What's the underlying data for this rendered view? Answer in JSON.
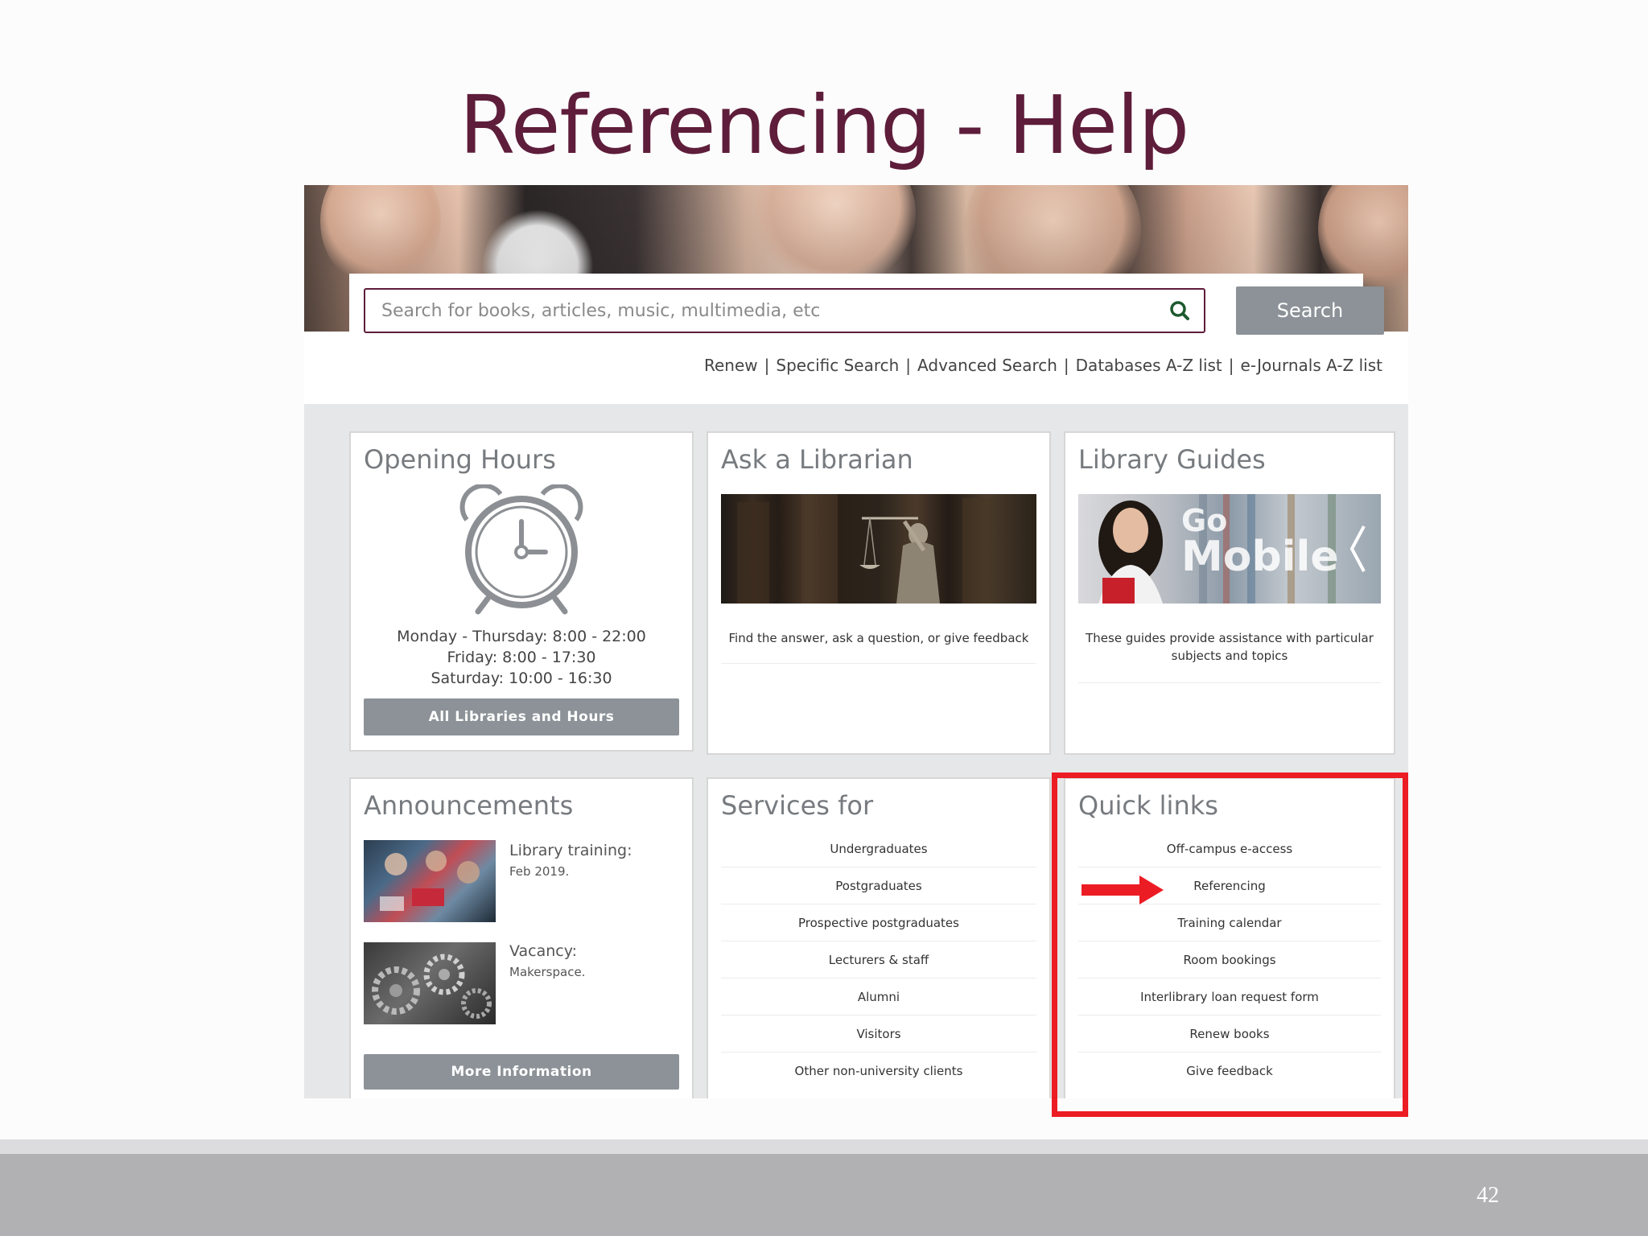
{
  "slide": {
    "title": "Referencing - Help",
    "page_number": "42"
  },
  "search": {
    "placeholder": "Search for books, articles, music, multimedia, etc",
    "button_label": "Search",
    "icon": "search-icon"
  },
  "quick_nav": [
    "Renew",
    "Specific Search",
    "Advanced Search",
    "Databases A-Z list",
    "e-Journals A-Z list"
  ],
  "cards": {
    "opening_hours": {
      "title": "Opening Hours",
      "icon": "alarm-clock-icon",
      "lines": [
        "Monday - Thursday: 8:00 - 22:00",
        "Friday: 8:00 - 17:30",
        "Saturday: 10:00 - 16:30"
      ],
      "button_label": "All Libraries and Hours"
    },
    "ask_librarian": {
      "title": "Ask a Librarian",
      "caption": "Find the answer, ask a question, or give feedback"
    },
    "library_guides": {
      "title": "Library Guides",
      "image_text_1": "Go",
      "image_text_2": "Mobile",
      "caption": "These guides provide assistance with particular subjects and topics"
    },
    "announcements": {
      "title": "Announcements",
      "items": [
        {
          "title": "Library training:",
          "subtitle": "Feb 2019."
        },
        {
          "title": "Vacancy:",
          "subtitle": "Makerspace."
        }
      ],
      "button_label": "More Information"
    },
    "services_for": {
      "title": "Services for",
      "items": [
        "Undergraduates",
        "Postgraduates",
        "Prospective postgraduates",
        "Lecturers & staff",
        "Alumni",
        "Visitors",
        "Other non-university clients"
      ]
    },
    "quick_links": {
      "title": "Quick links",
      "items": [
        "Off-campus e-access",
        "Referencing",
        "Training calendar",
        "Room bookings",
        "Interlibrary loan request form",
        "Renew books",
        "Give feedback"
      ]
    }
  },
  "colors": {
    "title": "#5e1d3a",
    "button_gray": "#8c9297",
    "highlight_red": "#ec1c24",
    "footer": "#b1b1b4"
  }
}
